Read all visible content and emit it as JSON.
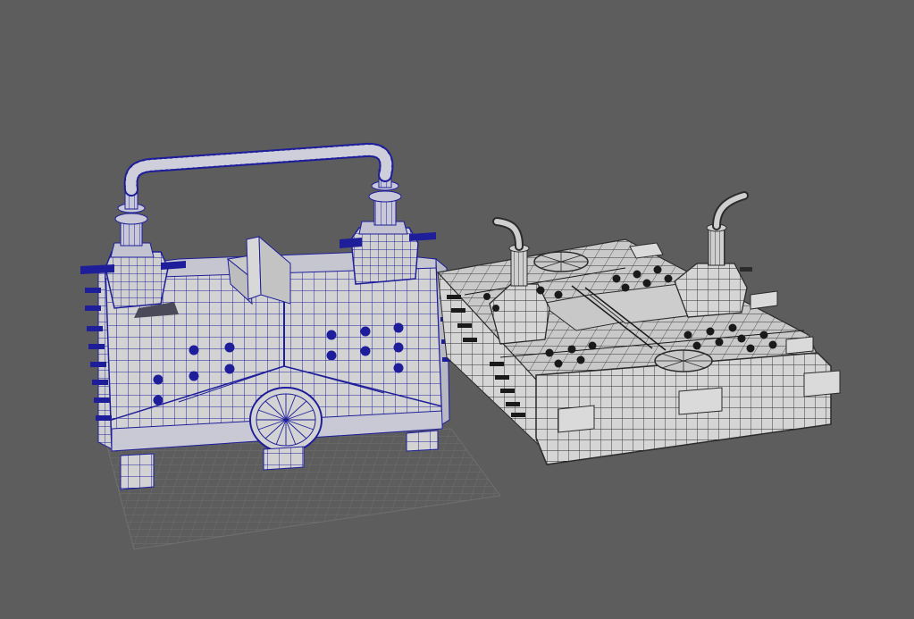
{
  "viewport": {
    "name": "3d-viewport",
    "background": "#5d5d5d",
    "grid_color": "#6f6f6f",
    "mesh_fill": "#d2d2d2",
    "mesh_shadow": "#a9a9a9",
    "wire_selected": "#1e1e9a",
    "wire_unselected": "#2a2a2a"
  },
  "objects": [
    {
      "name": "machine-model-selected",
      "state": "selected",
      "wire_color": "#1e1e9a"
    },
    {
      "name": "machine-model-unselected",
      "state": "unselected",
      "wire_color": "#2a2a2a"
    }
  ]
}
